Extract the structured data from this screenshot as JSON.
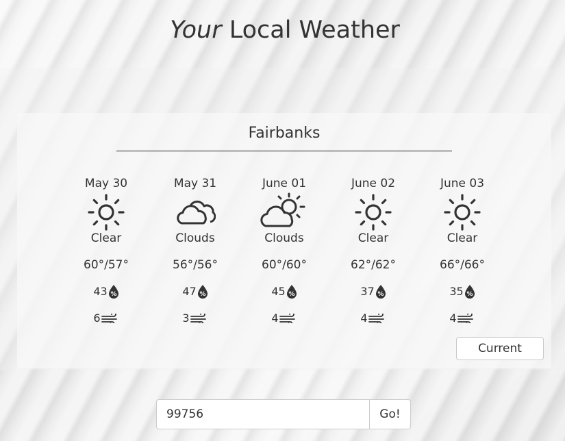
{
  "header": {
    "title_italic": "Your",
    "title_rest": " Local Weather"
  },
  "city": "Fairbanks",
  "forecast": [
    {
      "date": "May 30",
      "icon": "sun-icon",
      "condition": "Clear",
      "temp": "60°/57°",
      "humidity": "43",
      "wind": "6"
    },
    {
      "date": "May 31",
      "icon": "clouds-icon",
      "condition": "Clouds",
      "temp": "56°/56°",
      "humidity": "47",
      "wind": "3"
    },
    {
      "date": "June 01",
      "icon": "sun-behind-cloud-icon",
      "condition": "Clouds",
      "temp": "60°/60°",
      "humidity": "45",
      "wind": "4"
    },
    {
      "date": "June 02",
      "icon": "sun-icon",
      "condition": "Clear",
      "temp": "62°/62°",
      "humidity": "37",
      "wind": "4"
    },
    {
      "date": "June 03",
      "icon": "sun-icon",
      "condition": "Clear",
      "temp": "66°/66°",
      "humidity": "35",
      "wind": "4"
    }
  ],
  "buttons": {
    "current": "Current",
    "go": "Go!"
  },
  "search": {
    "value": "99756"
  }
}
